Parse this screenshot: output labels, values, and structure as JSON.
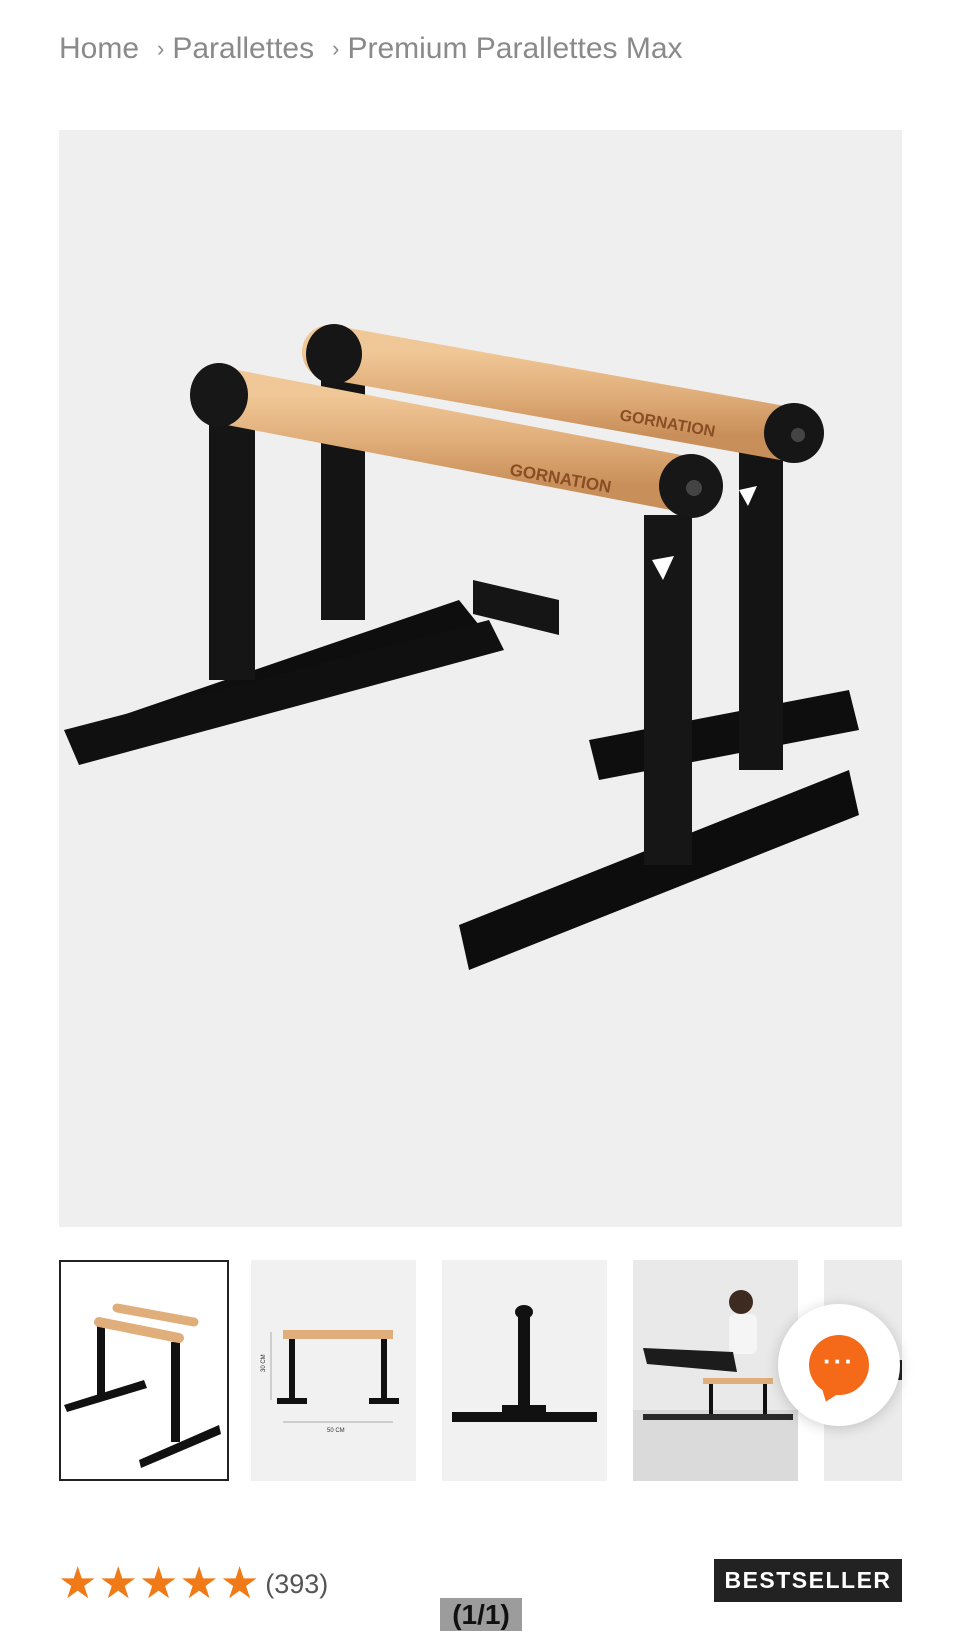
{
  "breadcrumb": {
    "home": "Home",
    "category": "Parallettes",
    "product": "Premium Parallettes Max",
    "separator": "›"
  },
  "product": {
    "brand_engraving": "GORNATION",
    "thumb_dimension_height": "30 CM",
    "thumb_dimension_width": "50 CM"
  },
  "rating": {
    "stars": 5,
    "review_count": "(393)"
  },
  "badge": {
    "label": "BESTSELLER"
  },
  "gallery": {
    "counter": "(1/1)"
  },
  "chat": {
    "icon": "chat-bubble-icon",
    "glyph": "···"
  },
  "colors": {
    "accent": "#f07a17",
    "chat": "#f46a18",
    "badge_bg": "#222222",
    "hero_bg": "#efefef",
    "wood": "#e0b07c",
    "metal": "#111111"
  }
}
